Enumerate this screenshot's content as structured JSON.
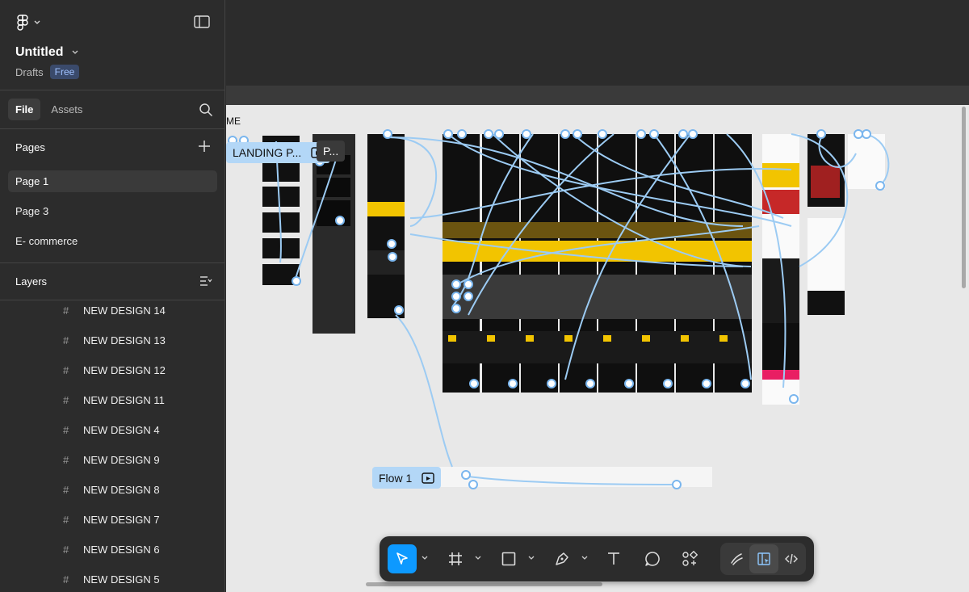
{
  "file": {
    "title": "Untitled",
    "location": "Drafts",
    "plan_badge": "Free"
  },
  "sidebar": {
    "tabs": [
      {
        "label": "File"
      },
      {
        "label": "Assets"
      }
    ],
    "pages_heading": "Pages",
    "pages": [
      {
        "label": "Page 1"
      },
      {
        "label": "Page 3"
      },
      {
        "label": "E- commerce"
      }
    ],
    "layers_heading": "Layers",
    "layers": [
      {
        "label": "NEW DESIGN 14"
      },
      {
        "label": "NEW DESIGN 13"
      },
      {
        "label": "NEW DESIGN 12"
      },
      {
        "label": "NEW DESIGN 11"
      },
      {
        "label": "NEW DESIGN 4"
      },
      {
        "label": "NEW DESIGN 9"
      },
      {
        "label": "NEW DESIGN 8"
      },
      {
        "label": "NEW DESIGN 7"
      },
      {
        "label": "NEW DESIGN 6"
      },
      {
        "label": "NEW DESIGN 5"
      }
    ]
  },
  "canvas": {
    "frame_label": "ME",
    "flow_tags": [
      {
        "label": "LANDING P..."
      },
      {
        "label": "P..."
      },
      {
        "label": "Flow 1"
      }
    ]
  },
  "toolbar": {
    "tools": [
      "move-tool",
      "frame-tool",
      "shape-tool",
      "pen-tool",
      "text-tool",
      "comment-tool",
      "actions-tool"
    ],
    "dev_tools": [
      "draw-mode",
      "design-mode",
      "dev-mode"
    ]
  },
  "colors": {
    "accent": "#0d99ff",
    "flow": "#9ccbf3",
    "canvas": "#e8e8e8",
    "panel": "#2c2c2c"
  }
}
